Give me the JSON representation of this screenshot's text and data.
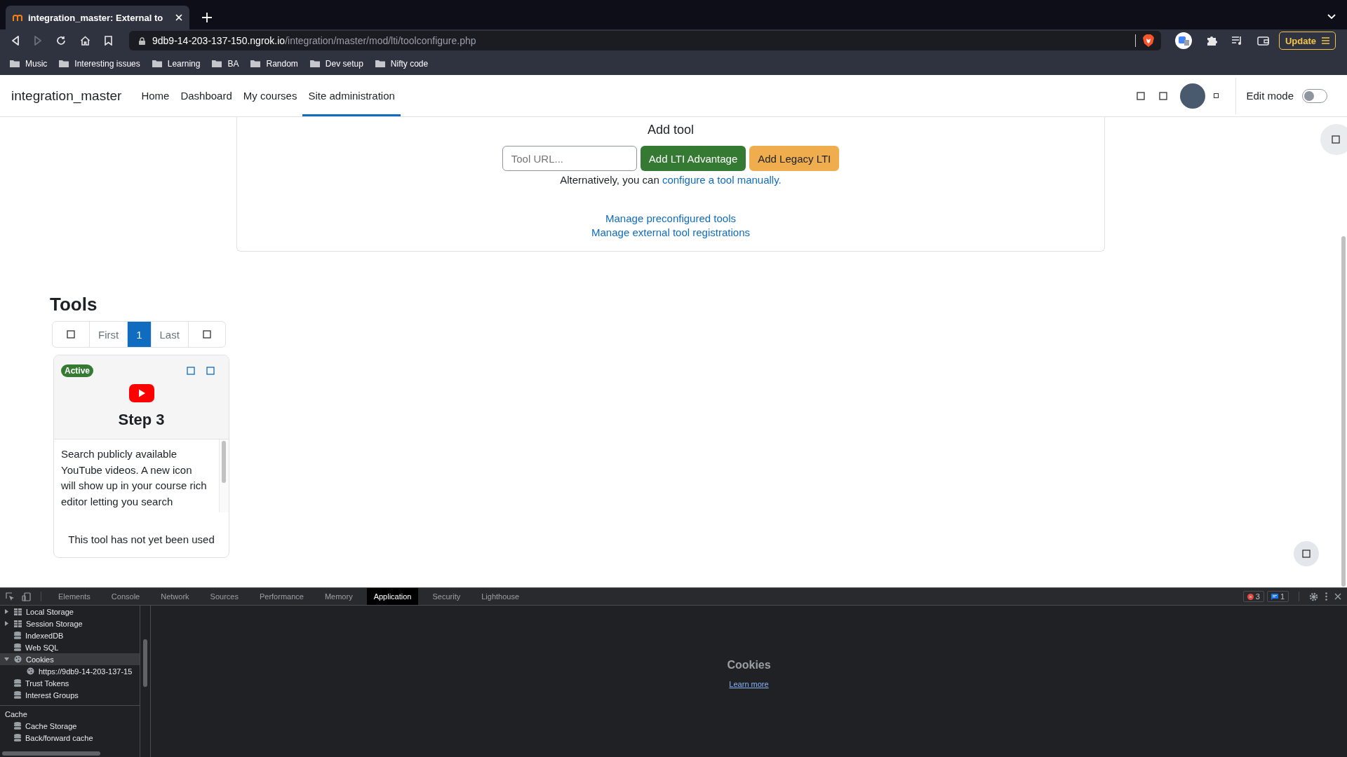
{
  "browser": {
    "tab_title": "integration_master: External to",
    "url_host": "9db9-14-203-137-150.ngrok.io",
    "url_path": "/integration/master/mod/lti/toolconfigure.php",
    "update_label": "Update",
    "bookmarks": [
      "Music",
      "Interesting issues",
      "Learning",
      "BA",
      "Random",
      "Dev setup",
      "Nifty code"
    ]
  },
  "site": {
    "name": "integration_master",
    "nav": [
      {
        "label": "Home",
        "selected": false
      },
      {
        "label": "Dashboard",
        "selected": false
      },
      {
        "label": "My courses",
        "selected": false
      },
      {
        "label": "Site administration",
        "selected": true
      }
    ],
    "edit_mode": {
      "label": "Edit mode",
      "on": false
    }
  },
  "add_tool": {
    "title": "Add tool",
    "url_field": {
      "placeholder": "Tool URL..."
    },
    "buttons": [
      {
        "label": "Add LTI Advantage",
        "kind": "primary"
      },
      {
        "label": "Add Legacy LTI",
        "kind": "warning"
      }
    ],
    "alt_text": "Alternatively, you can",
    "alt_link": "configure a tool manually.",
    "links": [
      "Manage preconfigured tools",
      "Manage external tool registrations"
    ]
  },
  "tools": {
    "title": "Tools",
    "pagination": [
      {
        "label": "First",
        "selected": false
      },
      {
        "label": "1",
        "selected": true
      },
      {
        "label": "Last",
        "selected": false
      }
    ],
    "cards": [
      {
        "status": "Active",
        "name": "Step 3",
        "description": "Search publicly available YouTube videos. A new icon will show up in your course rich editor letting you search",
        "usage": "This tool has not yet been used"
      }
    ]
  },
  "devtools": {
    "tabs": [
      {
        "label": "Elements",
        "selected": false
      },
      {
        "label": "Console",
        "selected": false
      },
      {
        "label": "Network",
        "selected": false
      },
      {
        "label": "Sources",
        "selected": false
      },
      {
        "label": "Performance",
        "selected": false
      },
      {
        "label": "Memory",
        "selected": false
      },
      {
        "label": "Application",
        "selected": true
      },
      {
        "label": "Security",
        "selected": false
      },
      {
        "label": "Lighthouse",
        "selected": false
      }
    ],
    "error_count": "3",
    "message_count": "1",
    "tree": [
      {
        "label": "Local Storage",
        "kind": "grid",
        "expanded": false,
        "selected": false
      },
      {
        "label": "Session Storage",
        "kind": "grid",
        "expanded": false,
        "selected": false
      },
      {
        "label": "IndexedDB",
        "kind": "db",
        "selected": false
      },
      {
        "label": "Web SQL",
        "kind": "db",
        "selected": false
      },
      {
        "label": "Cookies",
        "kind": "cookie",
        "expanded": true,
        "selected": true,
        "children": [
          {
            "label": "https://9db9-14-203-137-15",
            "kind": "cookie",
            "selected": false
          }
        ]
      },
      {
        "label": "Trust Tokens",
        "kind": "db",
        "selected": false
      },
      {
        "label": "Interest Groups",
        "kind": "db",
        "selected": false
      }
    ],
    "cache_heading": "Cache",
    "cache_items": [
      {
        "label": "Cache Storage",
        "kind": "db",
        "selected": false
      },
      {
        "label": "Back/forward cache",
        "kind": "db",
        "selected": false
      }
    ],
    "pane_title": "Cookies",
    "pane_link": "Learn more"
  }
}
